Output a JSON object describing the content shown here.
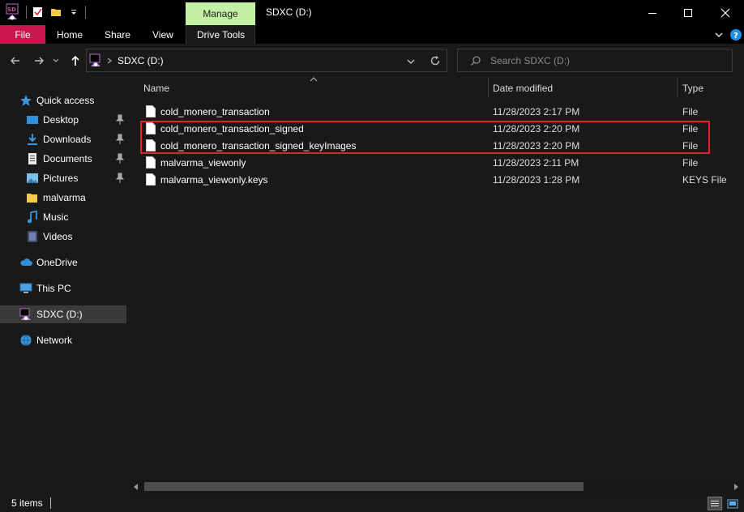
{
  "window": {
    "title": "SDXC (D:)",
    "manage_tab": "Manage"
  },
  "ribbon": {
    "tabs": [
      "File",
      "Home",
      "Share",
      "View",
      "Drive Tools"
    ]
  },
  "address": {
    "path": "SDXC (D:)",
    "search_placeholder": "Search SDXC (D:)"
  },
  "sidebar": {
    "quick_access": "Quick access",
    "items": [
      {
        "label": "Desktop",
        "icon": "desktop-icon",
        "pinned": true
      },
      {
        "label": "Downloads",
        "icon": "downloads-icon",
        "pinned": true
      },
      {
        "label": "Documents",
        "icon": "documents-icon",
        "pinned": true
      },
      {
        "label": "Pictures",
        "icon": "pictures-icon",
        "pinned": true
      },
      {
        "label": "malvarma",
        "icon": "folder-icon",
        "pinned": false
      },
      {
        "label": "Music",
        "icon": "music-icon",
        "pinned": false
      },
      {
        "label": "Videos",
        "icon": "videos-icon",
        "pinned": false
      }
    ],
    "onedrive": "OneDrive",
    "thispc": "This PC",
    "drive": "SDXC (D:)",
    "network": "Network"
  },
  "columns": {
    "name": "Name",
    "date": "Date modified",
    "type": "Type"
  },
  "files": [
    {
      "name": "cold_monero_transaction",
      "date": "11/28/2023 2:17 PM",
      "type": "File"
    },
    {
      "name": "cold_monero_transaction_signed",
      "date": "11/28/2023 2:20 PM",
      "type": "File"
    },
    {
      "name": "cold_monero_transaction_signed_keyImages",
      "date": "11/28/2023 2:20 PM",
      "type": "File"
    },
    {
      "name": "malvarma_viewonly",
      "date": "11/28/2023 2:11 PM",
      "type": "File"
    },
    {
      "name": "malvarma_viewonly.keys",
      "date": "11/28/2023 1:28 PM",
      "type": "KEYS File"
    }
  ],
  "status": {
    "count": "5 items"
  },
  "colors": {
    "file_tab": "#c8174f",
    "manage_tab": "#c4f0a6",
    "highlight": "#d9262b",
    "accent": "#1e8fe6"
  }
}
